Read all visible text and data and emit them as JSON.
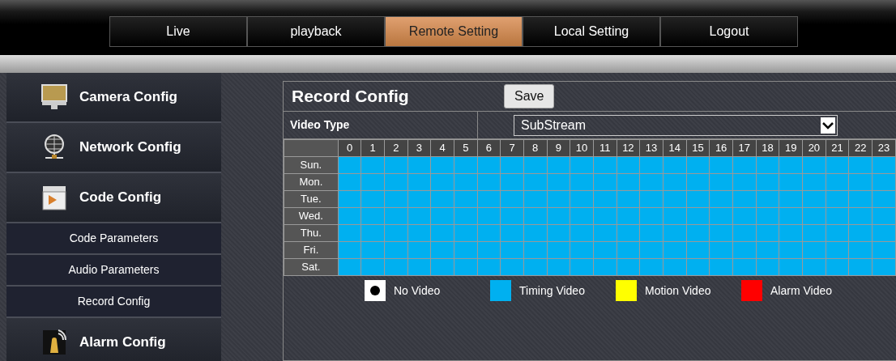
{
  "nav": [
    {
      "label": "Live",
      "selected": false
    },
    {
      "label": "playback",
      "selected": false
    },
    {
      "label": "Remote Setting",
      "selected": true
    },
    {
      "label": "Local Setting",
      "selected": false
    },
    {
      "label": "Logout",
      "selected": false
    }
  ],
  "sidebar": {
    "items": [
      {
        "label": "Camera Config",
        "kind": "section"
      },
      {
        "label": "Network Config",
        "kind": "section"
      },
      {
        "label": "Code Config",
        "kind": "section"
      },
      {
        "label": "Code Parameters",
        "kind": "sub"
      },
      {
        "label": "Audio Parameters",
        "kind": "sub"
      },
      {
        "label": "Record Config",
        "kind": "sub"
      },
      {
        "label": "Alarm Config",
        "kind": "section"
      }
    ]
  },
  "panel": {
    "title": "Record Config",
    "save_button": "Save",
    "video_type_label": "Video Type",
    "video_type_value": "SubStream",
    "hours": [
      "0",
      "1",
      "2",
      "3",
      "4",
      "5",
      "6",
      "7",
      "8",
      "9",
      "10",
      "11",
      "12",
      "13",
      "14",
      "15",
      "16",
      "17",
      "18",
      "19",
      "20",
      "21",
      "22",
      "23"
    ],
    "days": [
      {
        "label": "Sun.",
        "timing": [
          true,
          true,
          true,
          true,
          true,
          true,
          true,
          true,
          true,
          true,
          true,
          true,
          true,
          true,
          true,
          true,
          true,
          true,
          true,
          true,
          true,
          true,
          true,
          true
        ]
      },
      {
        "label": "Mon.",
        "timing": [
          true,
          true,
          true,
          true,
          true,
          true,
          true,
          true,
          true,
          true,
          true,
          true,
          true,
          true,
          true,
          true,
          true,
          true,
          true,
          true,
          true,
          true,
          true,
          true
        ]
      },
      {
        "label": "Tue.",
        "timing": [
          true,
          true,
          true,
          true,
          true,
          true,
          true,
          true,
          true,
          true,
          true,
          true,
          true,
          true,
          true,
          true,
          true,
          true,
          true,
          true,
          true,
          true,
          true,
          true
        ]
      },
      {
        "label": "Wed.",
        "timing": [
          true,
          true,
          true,
          true,
          true,
          true,
          true,
          true,
          true,
          true,
          true,
          true,
          true,
          true,
          true,
          true,
          true,
          true,
          true,
          true,
          true,
          true,
          true,
          true
        ]
      },
      {
        "label": "Thu.",
        "timing": [
          true,
          true,
          true,
          true,
          true,
          true,
          true,
          true,
          true,
          true,
          true,
          true,
          true,
          true,
          true,
          true,
          true,
          true,
          true,
          true,
          true,
          true,
          true,
          true
        ]
      },
      {
        "label": "Fri.",
        "timing": [
          true,
          true,
          true,
          true,
          true,
          true,
          true,
          true,
          true,
          true,
          true,
          true,
          true,
          true,
          true,
          true,
          true,
          true,
          true,
          true,
          true,
          true,
          true,
          true
        ]
      },
      {
        "label": "Sat.",
        "timing": [
          true,
          true,
          true,
          true,
          true,
          true,
          true,
          true,
          true,
          true,
          true,
          true,
          true,
          true,
          true,
          true,
          true,
          true,
          true,
          true,
          true,
          true,
          true,
          true
        ]
      }
    ],
    "legend": [
      {
        "kind": "none",
        "label": "No Video",
        "color": "#ffffff"
      },
      {
        "kind": "timing",
        "label": "Timing Video",
        "color": "#00b0f0"
      },
      {
        "kind": "motion",
        "label": "Motion Video",
        "color": "#ffff00"
      },
      {
        "kind": "alarm",
        "label": "Alarm Video",
        "color": "#ff0000"
      }
    ]
  }
}
